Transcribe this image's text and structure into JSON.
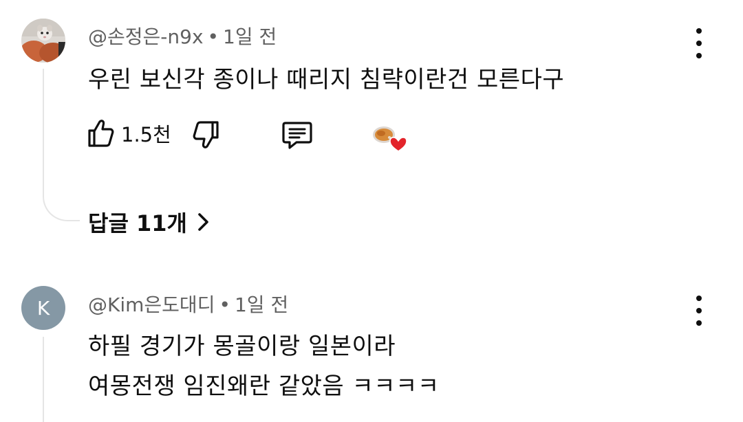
{
  "comments": [
    {
      "author": "@손정은-n9x",
      "separator": "•",
      "time": "1일 전",
      "lines": [
        "우린 보신각 종이나 때리지 침략이란건 모른다구"
      ],
      "likes": "1.5천",
      "replies_label": "답글 11개",
      "avatar_icon": "hamster-photo-avatar",
      "creator_heart_icon": "creator-heart-icon"
    },
    {
      "author": "@Kim은도대디",
      "separator": "•",
      "time": "1일 전",
      "lines": [
        "하필 경기가 몽골이랑 일본이라",
        "여몽전쟁 임진왜란 같았음 ㅋㅋㅋㅋ"
      ],
      "avatar_letter": "K",
      "avatar_color": "#8598a5"
    }
  ],
  "icons": {
    "like": "thumb-up-icon",
    "dislike": "thumb-down-icon",
    "reply": "comment-icon",
    "more": "more-vert-icon",
    "chevron": "chevron-right-icon"
  }
}
